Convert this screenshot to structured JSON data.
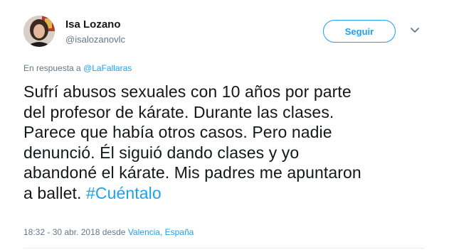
{
  "author": {
    "name": "Isa Lozano",
    "handle": "@isalozanovlc"
  },
  "follow_button": {
    "label": "Seguir"
  },
  "menu": {
    "icon": "chevron-down-icon"
  },
  "reply_context": {
    "prefix": "En respuesta a",
    "mention": "@LaFallaras"
  },
  "tweet": {
    "line1": "Sufrí abusos sexuales con 10 años por parte",
    "line2": "del profesor de kárate. Durante las clases.",
    "line3": "Parece que había otros casos. Pero nadie",
    "line4": "denunció. Él siguió dando clases y yo",
    "line5": "abandoné el kárate. Mis padres me apuntaron",
    "line6_prefix": "a ballet.",
    "hashtag": "#Cuéntalo"
  },
  "meta": {
    "timestamp": "18:32 - 30 abr. 2018",
    "from_label": "desde",
    "location": "Valencia, España"
  },
  "colors": {
    "accent": "#1da1f2",
    "text": "#14171a",
    "muted": "#657786"
  }
}
